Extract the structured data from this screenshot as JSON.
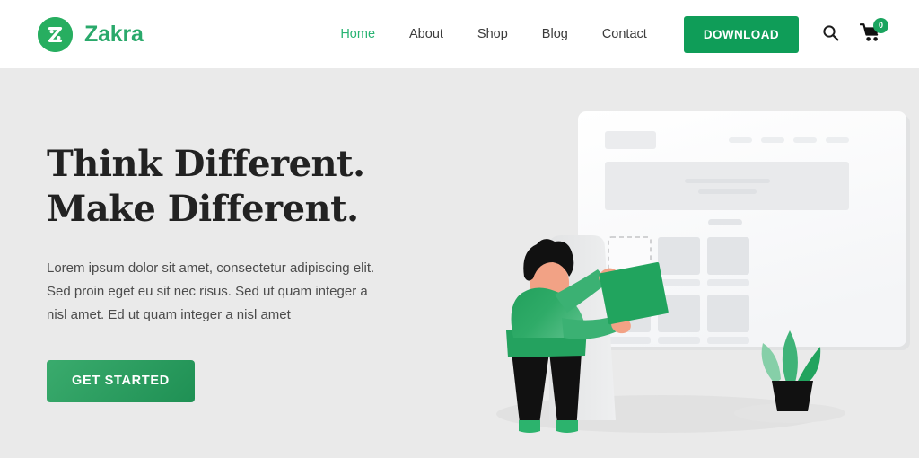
{
  "brand": {
    "name": "Zakra",
    "logo_icon": "zakra-circle-z-icon",
    "color": "#2aa96b"
  },
  "header": {
    "nav": [
      {
        "label": "Home",
        "active": true
      },
      {
        "label": "About",
        "active": false
      },
      {
        "label": "Shop",
        "active": false
      },
      {
        "label": "Blog",
        "active": false
      },
      {
        "label": "Contact",
        "active": false
      }
    ],
    "download_label": "DOWNLOAD",
    "search_icon": "search-icon",
    "cart_icon": "shopping-cart-icon",
    "cart_count": "0",
    "accent_color": "#0f9d58",
    "background": "#ffffff"
  },
  "hero": {
    "title_line1": "Think Different.",
    "title_line2": "Make Different.",
    "description": "Lorem ipsum dolor sit amet, consectetur adipiscing elit. Sed proin eget eu sit nec risus. Sed ut quam integer a nisl amet.  Ed ut quam integer a nisl amet",
    "cta_label": "GET STARTED",
    "background": "#eaeaea",
    "title_color": "#222222",
    "illustration": {
      "name": "person-placing-card-on-website-wireframe-illustration",
      "browser_mockup": "website-wireframe-panel",
      "person": "standing-person-holding-green-card",
      "plant": "potted-plant",
      "card_color": "#21a45e",
      "sweater_color": "#2ba565",
      "skin_color": "#f2a285",
      "hair_color": "#111111",
      "trousers_color": "#111111",
      "shoe_color": "#2cb36d"
    }
  }
}
